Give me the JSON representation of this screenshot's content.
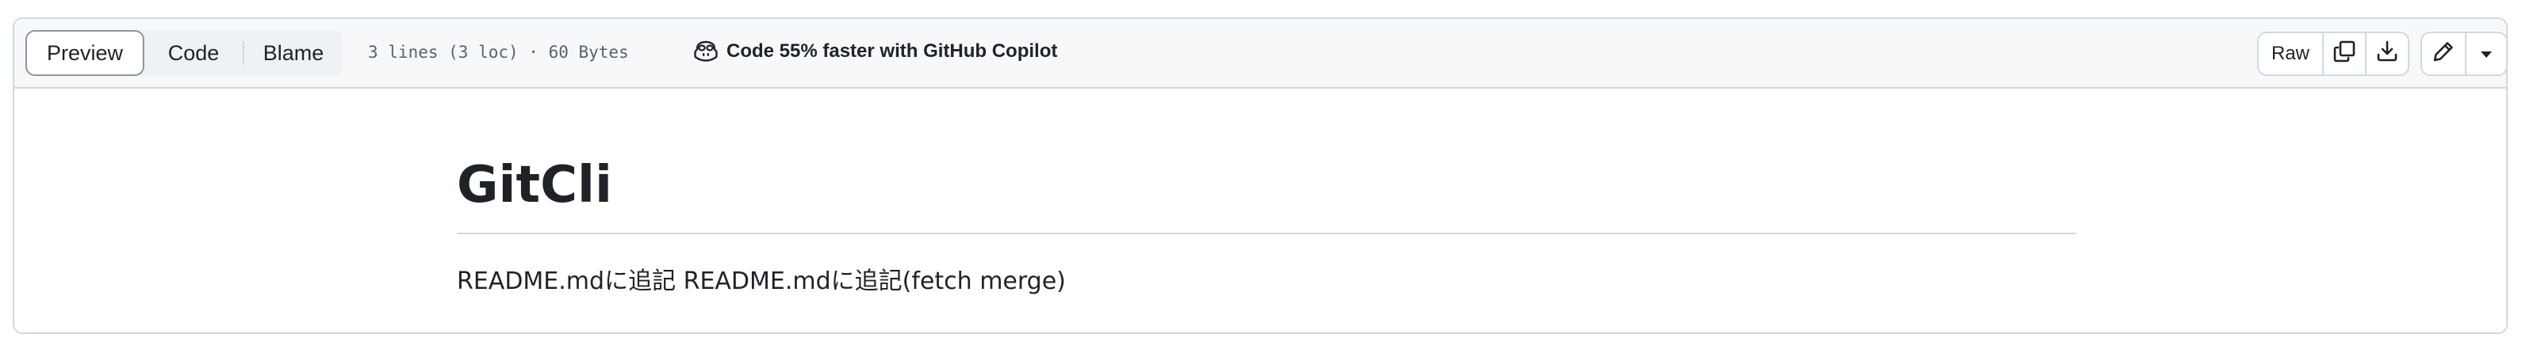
{
  "toolbar": {
    "tabs": [
      {
        "label": "Preview",
        "selected": true
      },
      {
        "label": "Code",
        "selected": false
      },
      {
        "label": "Blame",
        "selected": false
      }
    ],
    "file_info": "3 lines (3 loc) · 60 Bytes",
    "copilot_text": "Code 55% faster with GitHub Copilot",
    "raw_label": "Raw",
    "icons": {
      "copilot": "copilot-icon",
      "copy": "copy-icon",
      "download": "download-icon",
      "edit": "pencil-icon",
      "dropdown": "triangle-down-icon"
    }
  },
  "readme": {
    "title": "GitCli",
    "body": "README.mdに追記 README.mdに追記(fetch merge)"
  },
  "colors": {
    "border": "#d1d9e0",
    "header_bg": "#f6f8fa",
    "text": "#1f2328",
    "muted": "#59636e"
  }
}
